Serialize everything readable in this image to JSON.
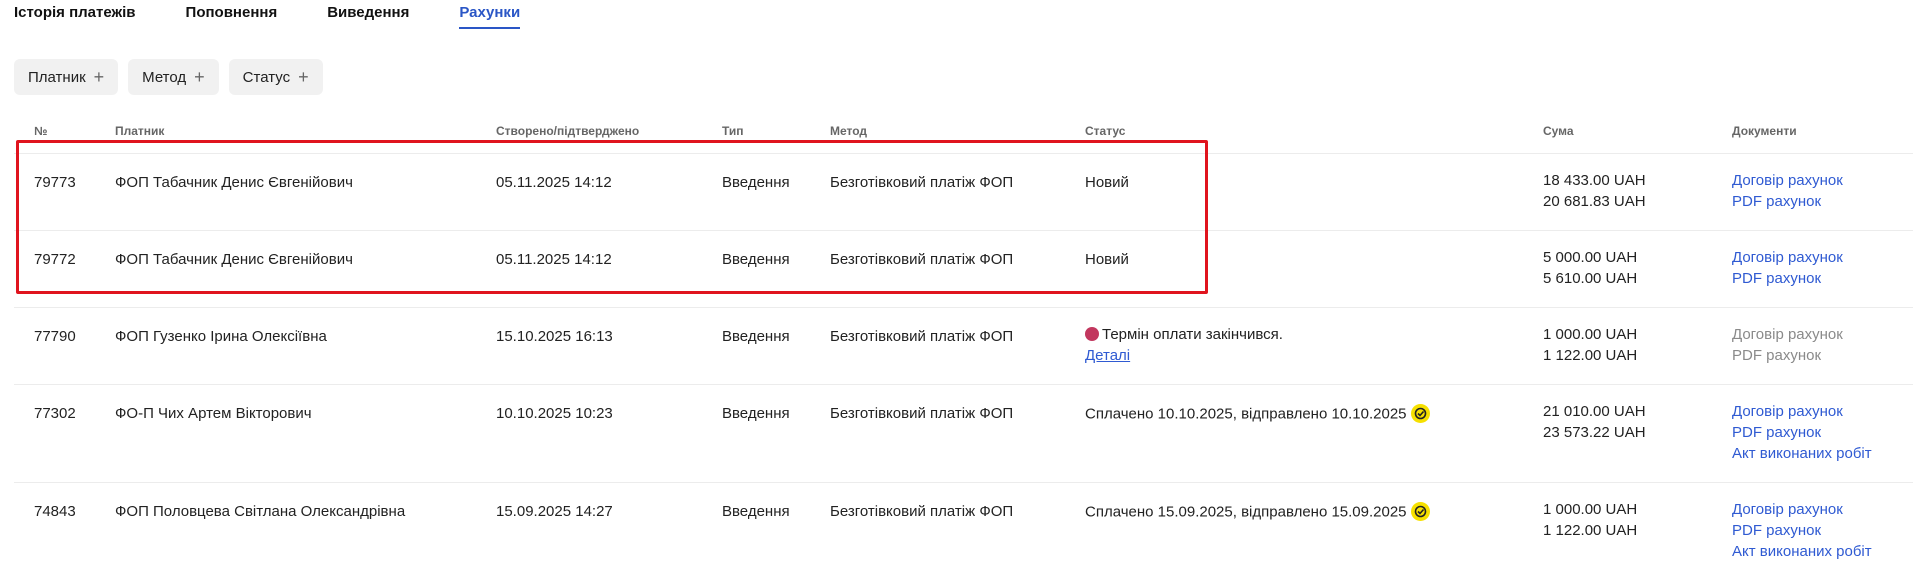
{
  "tabs": [
    {
      "label": "Історія платежів"
    },
    {
      "label": "Поповнення"
    },
    {
      "label": "Виведення"
    },
    {
      "label": "Рахунки"
    }
  ],
  "active_tab": "Рахунки",
  "filters": [
    {
      "label": "Платник"
    },
    {
      "label": "Метод"
    },
    {
      "label": "Статус"
    }
  ],
  "columns": {
    "num": "№",
    "payer": "Платник",
    "created": "Створено/підтверджено",
    "type": "Тип",
    "method": "Метод",
    "status": "Статус",
    "sum": "Сума",
    "docs": "Документи"
  },
  "rows": [
    {
      "num": "79773",
      "payer": "ФОП Табачник Денис Євгенійович",
      "created": "05.11.2025 14:12",
      "type": "Введення",
      "method": "Безготівковий платіж ФОП",
      "status": "Новий",
      "sum1": "18 433.00 UAH",
      "sum2": "20 681.83 UAH",
      "doc1": "Договір рахунок",
      "doc2": "PDF рахунок"
    },
    {
      "num": "79772",
      "payer": "ФОП Табачник Денис Євгенійович",
      "created": "05.11.2025 14:12",
      "type": "Введення",
      "method": "Безготівковий платіж ФОП",
      "status": "Новий",
      "sum1": "5 000.00 UAH",
      "sum2": "5 610.00 UAH",
      "doc1": "Договір рахунок",
      "doc2": "PDF рахунок"
    },
    {
      "num": "77790",
      "payer": "ФОП Гузенко Ірина Олексіївна",
      "created": "15.10.2025 16:13",
      "type": "Введення",
      "method": "Безготівковий платіж ФОП",
      "status": "Термін оплати закінчився.",
      "status_link": "Деталі",
      "sum1": "1 000.00 UAH",
      "sum2": "1 122.00 UAH",
      "doc1": "Договір рахунок",
      "doc2": "PDF рахунок"
    },
    {
      "num": "77302",
      "payer": "ФО-П Чих Артем Вікторович",
      "created": "10.10.2025 10:23",
      "type": "Введення",
      "method": "Безготівковий платіж ФОП",
      "status": "Сплачено 10.10.2025, відправлено 10.10.2025",
      "sum1": "21 010.00 UAH",
      "sum2": "23 573.22 UAH",
      "doc1": "Договір рахунок",
      "doc2": "PDF рахунок",
      "doc3": "Акт виконаних робіт"
    },
    {
      "num": "74843",
      "payer": "ФОП Половцева Світлана Олександрівна",
      "created": "15.09.2025 14:27",
      "type": "Введення",
      "method": "Безготівковий платіж ФОП",
      "status": "Сплачено 15.09.2025, відправлено 15.09.2025",
      "sum1": "1 000.00 UAH",
      "sum2": "1 122.00 UAH",
      "doc1": "Договір рахунок",
      "doc2": "PDF рахунок",
      "doc3": "Акт виконаних робіт"
    }
  ],
  "colors": {
    "accent": "#2a56c6",
    "link": "#2f5ad2",
    "disabled_link": "#8a8a8a",
    "highlight": "#e0141e",
    "paid_badge": "#f6e000",
    "expired_dot": "#c2375e"
  },
  "icons": {
    "filter_add": "plus-icon",
    "paid": "check-badge-icon",
    "expired": "expired-dot-icon"
  }
}
